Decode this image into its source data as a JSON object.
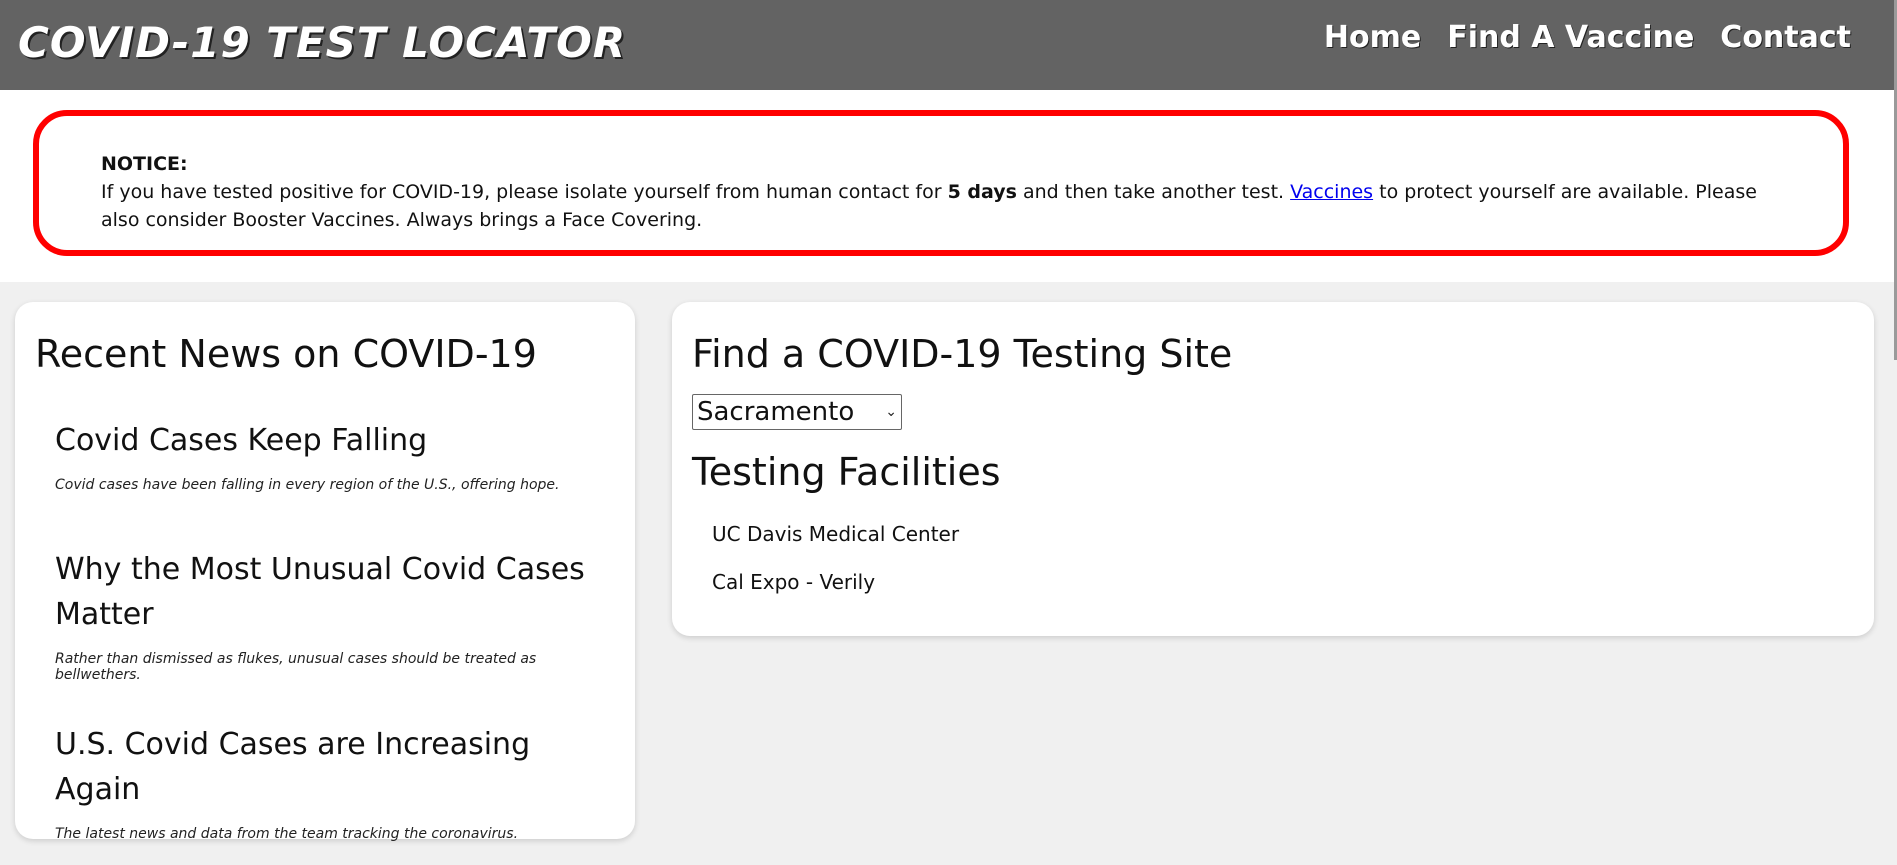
{
  "header": {
    "logo": "COVID-19 TEST LOCATOR",
    "nav": [
      "Home",
      "Find A Vaccine",
      "Contact"
    ]
  },
  "notice": {
    "title": "NOTICE:",
    "text_before": "If you have tested positive for COVID-19, please isolate yourself from human contact for ",
    "bold": "5 days",
    "text_middle": " and then take another test. ",
    "link": "Vaccines",
    "text_after": " to protect yourself are available. Please also consider Booster Vaccines. Always brings a Face Covering.",
    "border_color": "#ff0000"
  },
  "news": {
    "title": "Recent News on COVID-19",
    "items": [
      {
        "headline": "Covid Cases Keep Falling",
        "summary": "Covid cases have been falling in every region of the U.S., offering hope."
      },
      {
        "headline": "Why the Most Unusual Covid Cases Matter",
        "summary": "Rather than dismissed as flukes, unusual cases should be treated as bellwethers."
      },
      {
        "headline": "U.S. Covid Cases are Increasing Again",
        "summary": "The latest news and data from the team tracking the coronavirus."
      }
    ]
  },
  "sites": {
    "title": "Find a COVID-19 Testing Site",
    "selected_city": "Sacramento",
    "facilities_title": "Testing Facilities",
    "facilities": [
      "UC Davis Medical Center",
      "Cal Expo - Verily"
    ]
  }
}
